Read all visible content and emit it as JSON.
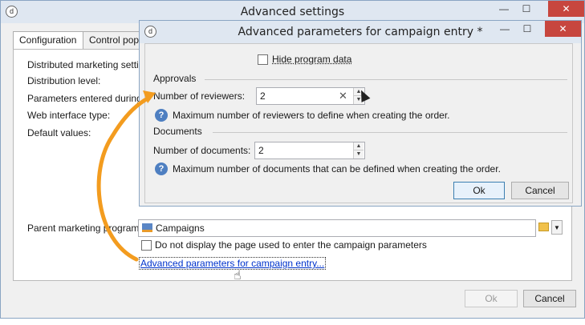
{
  "outer": {
    "title": "Advanced settings",
    "controls": {
      "minimize": "—",
      "maximize": "☐",
      "close": "✕"
    },
    "tabs": [
      "Configuration",
      "Control popu"
    ],
    "group_title": "Distributed marketing setting",
    "labels": {
      "distribution_level": "Distribution level:",
      "parameters_entered": "Parameters entered during th",
      "web_interface_type": "Web interface type:",
      "default_values": "Default values:",
      "parent_program": "Parent marketing program:"
    },
    "parent_program_value": "Campaigns",
    "checkbox_label": "Do not display the page used to enter the campaign parameters",
    "advanced_link": "Advanced parameters for campaign entry...",
    "ok": "Ok",
    "cancel": "Cancel"
  },
  "inner": {
    "title": "Advanced parameters for campaign entry *",
    "controls": {
      "minimize": "—",
      "maximize": "☐",
      "close": "✕"
    },
    "hide_program_label": "Hide program data",
    "approvals": {
      "section": "Approvals",
      "label": "Number of reviewers:",
      "value": "2",
      "help": "Maximum number of reviewers to define when creating the order."
    },
    "documents": {
      "section": "Documents",
      "label": "Number of documents:",
      "value": "2",
      "help": "Maximum number of documents that can be defined when creating the order."
    },
    "ok": "Ok",
    "cancel": "Cancel"
  },
  "colors": {
    "accent": "#f39c1f",
    "link": "#0033cc",
    "close": "#c7463e",
    "titlebar": "#dfe7f1"
  }
}
